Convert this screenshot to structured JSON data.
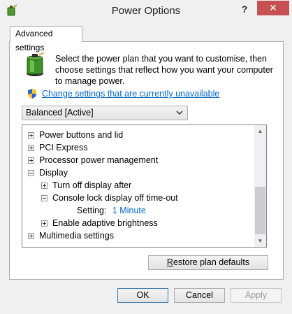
{
  "window": {
    "title": "Power Options",
    "help_label": "?",
    "close_label": "✕"
  },
  "tabs": [
    {
      "label": "Advanced settings",
      "selected": true
    }
  ],
  "description": "Select the power plan that you want to customise, then choose settings that reflect how you want your computer to manage power.",
  "change_link": "Change settings that are currently unavailable",
  "plan_select": {
    "value": "Balanced [Active]",
    "icon": "chevron-down-icon"
  },
  "tree": {
    "items": [
      {
        "label": "Power buttons and lid",
        "expander": "plus",
        "level": 0
      },
      {
        "label": "PCI Express",
        "expander": "plus",
        "level": 0
      },
      {
        "label": "Processor power management",
        "expander": "plus",
        "level": 0
      },
      {
        "label": "Display",
        "expander": "minus",
        "level": 0
      },
      {
        "label": "Turn off display after",
        "expander": "plus",
        "level": 1
      },
      {
        "label": "Console lock display off time-out",
        "expander": "minus",
        "level": 1
      },
      {
        "label": "Enable adaptive brightness",
        "expander": "plus",
        "level": 1
      },
      {
        "label": "Multimedia settings",
        "expander": "plus",
        "level": 0
      }
    ],
    "setting": {
      "label": "Setting:",
      "value": "1 Minute"
    }
  },
  "buttons": {
    "restore_first": "R",
    "restore_rest": "estore plan defaults",
    "ok": "OK",
    "cancel": "Cancel",
    "apply": "Apply"
  },
  "colors": {
    "link": "#0066cc",
    "close_button": "#c75050",
    "window_bg": "#f0f0f0"
  }
}
